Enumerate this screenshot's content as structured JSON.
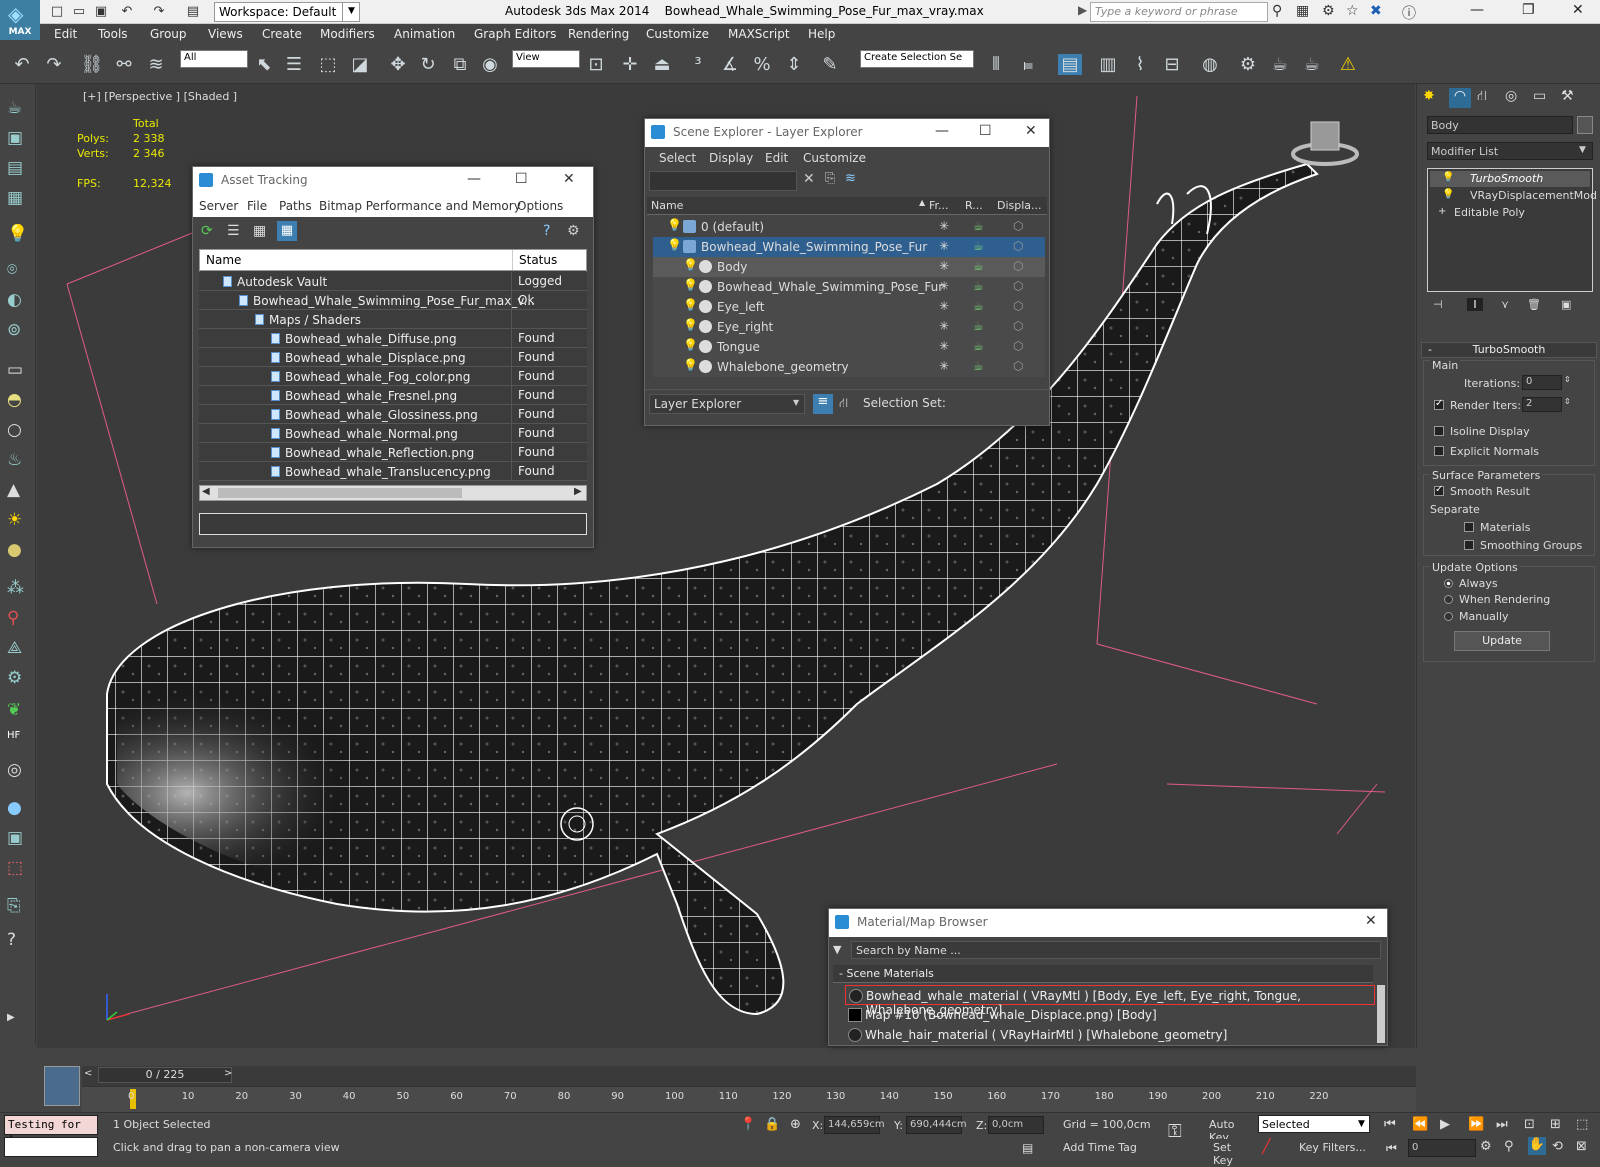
{
  "title": {
    "logo": "MAX",
    "workspace": "Workspace: Default",
    "app": "Autodesk 3ds Max  2014",
    "file": "Bowhead_Whale_Swimming_Pose_Fur_max_vray.max",
    "search_placeholder": "Type a keyword or phrase"
  },
  "menu": [
    "Edit",
    "Tools",
    "Group",
    "Views",
    "Create",
    "Modifiers",
    "Animation",
    "Graph Editors",
    "Rendering",
    "Customize",
    "MAXScript",
    "Help"
  ],
  "toolbar": {
    "filter": "All",
    "refcoord": "View",
    "selection_set": "Create Selection Se"
  },
  "viewport": {
    "label": "[+] [Perspective ] [Shaded ]",
    "stats": {
      "header": "Total",
      "polys_label": "Polys:",
      "polys": "2 338",
      "verts_label": "Verts:",
      "verts": "2 346",
      "fps_label": "FPS:",
      "fps": "12,324"
    }
  },
  "asset_tracking": {
    "title": "Asset Tracking",
    "menu": [
      "Server",
      "File",
      "Paths",
      "Bitmap Performance and Memory",
      "Options"
    ],
    "col_name": "Name",
    "col_status": "Status",
    "rows": [
      {
        "name": "Autodesk Vault",
        "status": "Logged Out ...",
        "indent": 0
      },
      {
        "name": "Bowhead_Whale_Swimming_Pose_Fur_max_v...",
        "status": "Ok",
        "indent": 1
      },
      {
        "name": "Maps / Shaders",
        "status": "",
        "indent": 2
      },
      {
        "name": "Bowhead_whale_Diffuse.png",
        "status": "Found",
        "indent": 3
      },
      {
        "name": "Bowhead_whale_Displace.png",
        "status": "Found",
        "indent": 3
      },
      {
        "name": "Bowhead_whale_Fog_color.png",
        "status": "Found",
        "indent": 3
      },
      {
        "name": "Bowhead_whale_Fresnel.png",
        "status": "Found",
        "indent": 3
      },
      {
        "name": "Bowhead_whale_Glossiness.png",
        "status": "Found",
        "indent": 3
      },
      {
        "name": "Bowhead_whale_Normal.png",
        "status": "Found",
        "indent": 3
      },
      {
        "name": "Bowhead_whale_Reflection.png",
        "status": "Found",
        "indent": 3
      },
      {
        "name": "Bowhead_whale_Translucency.png",
        "status": "Found",
        "indent": 3
      }
    ]
  },
  "scene_explorer": {
    "title": "Scene Explorer - Layer Explorer",
    "menu": [
      "Select",
      "Display",
      "Edit",
      "Customize"
    ],
    "col_name": "Name",
    "col_fr": "Fr...",
    "col_r": "R...",
    "col_disp": "Displa...",
    "rows": [
      {
        "name": "0 (default)",
        "indent": 0,
        "selected": false
      },
      {
        "name": "Bowhead_Whale_Swimming_Pose_Fur",
        "indent": 0,
        "selected": true
      },
      {
        "name": "Body",
        "indent": 1,
        "selected": false,
        "hl": true
      },
      {
        "name": "Bowhead_Whale_Swimming_Pose_Fur",
        "indent": 1,
        "selected": false
      },
      {
        "name": "Eye_left",
        "indent": 1,
        "selected": false
      },
      {
        "name": "Eye_right",
        "indent": 1,
        "selected": false
      },
      {
        "name": "Tongue",
        "indent": 1,
        "selected": false
      },
      {
        "name": "Whalebone_geometry",
        "indent": 1,
        "selected": false
      }
    ],
    "footer_combo": "Layer Explorer",
    "selection_set": "Selection Set:"
  },
  "material_browser": {
    "title": "Material/Map Browser",
    "search": "Search by Name ...",
    "group": "- Scene Materials",
    "rows": [
      "Bowhead_whale_material  ( VRayMtl ) [Body, Eye_left, Eye_right, Tongue, Whalebone_geometry]",
      "Map #10 (Bowhead_whale_Displace.png) [Body]",
      "Whale_hair_material  ( VRayHairMtl ) [Whalebone_geometry]"
    ]
  },
  "command_panel": {
    "object_name": "Body",
    "modifier_list": "Modifier List",
    "stack": [
      "TurboSmooth",
      "VRayDisplacementMod",
      "Editable Poly"
    ],
    "rollout": "TurboSmooth",
    "main": "Main",
    "iterations_label": "Iterations:",
    "iterations": "0",
    "render_iters_label": "Render Iters:",
    "render_iters": "2",
    "isoline": "Isoline Display",
    "explicit_normals": "Explicit Normals",
    "surface_params": "Surface Parameters",
    "smooth_result": "Smooth Result",
    "separate": "Separate",
    "materials": "Materials",
    "smoothing_groups": "Smoothing Groups",
    "update_options": "Update Options",
    "always": "Always",
    "when_rendering": "When Rendering",
    "manually": "Manually",
    "update": "Update"
  },
  "timeline": {
    "frame": "0 / 225",
    "ticks": [
      "0",
      "10",
      "20",
      "30",
      "40",
      "50",
      "60",
      "70",
      "80",
      "90",
      "100",
      "110",
      "120",
      "130",
      "140",
      "150",
      "160",
      "170",
      "180",
      "190",
      "200",
      "210",
      "220"
    ]
  },
  "status": {
    "script": "Testing for ;",
    "selected": "1 Object Selected",
    "prompt": "Click and drag to pan a non-camera view",
    "x_label": "X:",
    "x": "144,659cm",
    "y_label": "Y:",
    "y": "690,444cm",
    "z_label": "Z:",
    "z": "0,0cm",
    "grid": "Grid = 100,0cm",
    "add_time_tag": "Add Time Tag",
    "auto_key": "Auto Key",
    "set_key": "Set Key",
    "key_mode": "Selected",
    "key_filters": "Key Filters...",
    "frame_field": "0"
  }
}
